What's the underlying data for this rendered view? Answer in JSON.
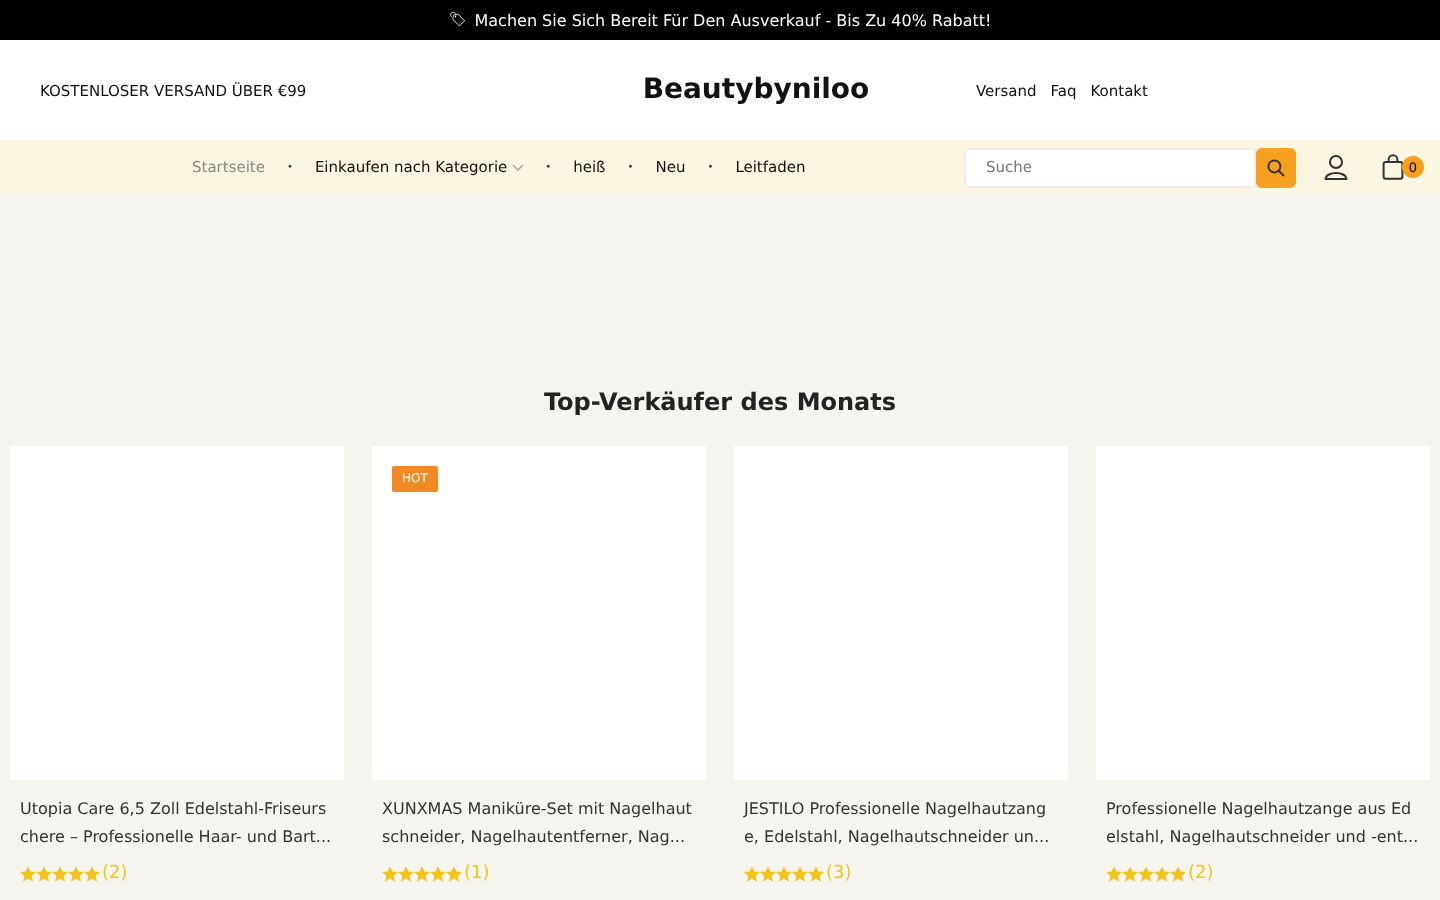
{
  "announcement": {
    "icon": "🏷",
    "text": "Machen Sie Sich Bereit Für Den Ausverkauf - Bis Zu 40% Rabatt!"
  },
  "header": {
    "shipping_note": "KOSTENLOSER VERSAND ÜBER €99",
    "logo": "Beautybyniloo",
    "links": [
      "Versand",
      "Faq",
      "Kontakt"
    ]
  },
  "nav": {
    "separator": "•",
    "items": [
      {
        "label": "Startseite",
        "selected": true,
        "dropdown": false
      },
      {
        "label": "Einkaufen nach Kategorie",
        "selected": false,
        "dropdown": true
      },
      {
        "label": "heiß",
        "selected": false,
        "dropdown": false
      },
      {
        "label": "Neu",
        "selected": false,
        "dropdown": false
      },
      {
        "label": "Leitfaden",
        "selected": false,
        "dropdown": false
      }
    ],
    "search": {
      "placeholder": "Suche"
    },
    "cart_count": "0"
  },
  "section_title": "Top-Verkäufer des Monats",
  "products": [
    {
      "title": "Utopia Care 6,5 Zoll Edelstahl-Friseurschere – Professionelle Haar- und Bart...",
      "stars": 5,
      "reviews": "(2)"
    },
    {
      "badge": "HOT",
      "title": "XUNXMAS Maniküre-Set mit Nagelhautschneider, Nagelhautentferner, Nag...",
      "stars": 5,
      "reviews": "(1)"
    },
    {
      "title": "JESTILO Professionelle Nagelhautzange, Edelstahl, Nagelhautschneider un...",
      "stars": 5,
      "reviews": "(3)"
    },
    {
      "title": "Professionelle Nagelhautzange aus Edelstahl, Nagelhautschneider und -ent...",
      "stars": 5,
      "reviews": "(2)"
    }
  ]
}
